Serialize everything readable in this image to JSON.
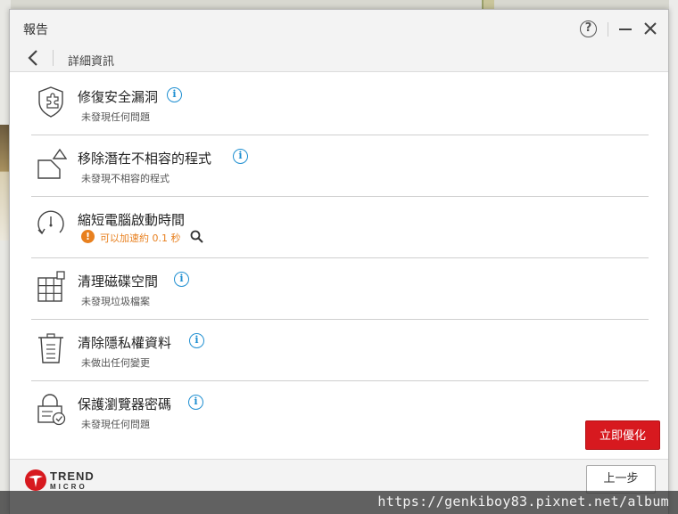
{
  "window": {
    "title": "報告",
    "help_label": "?",
    "breadcrumb": "詳細資訊"
  },
  "items": [
    {
      "icon": "shield-puzzle-icon",
      "title": "修復安全漏洞",
      "status": "未發現任何問題"
    },
    {
      "icon": "incompatible-app-icon",
      "title": "移除潛在不相容的程式",
      "status": "未發現不相容的程式"
    },
    {
      "icon": "startup-timer-icon",
      "title": "縮短電腦啟動時間",
      "status": "可以加速約 0.1 秒",
      "status_type": "warning"
    },
    {
      "icon": "disk-grid-icon",
      "title": "清理磁碟空間",
      "status": "未發現垃圾檔案"
    },
    {
      "icon": "trash-document-icon",
      "title": "清除隱私權資料",
      "status": "未做出任何變更"
    },
    {
      "icon": "lock-check-icon",
      "title": "保護瀏覽器密碼",
      "status": "未發現任何問題"
    }
  ],
  "info_glyph": "i",
  "warning_glyph": "!",
  "buttons": {
    "optimize": "立即優化",
    "previous": "上一步"
  },
  "logo": {
    "line1": "TREND",
    "line2": "MICRO"
  },
  "watermark": "https://genkiboy83.pixnet.net/album",
  "colors": {
    "accent_red": "#d7191f",
    "info_blue": "#1f8fd1",
    "warning_orange": "#e8801f"
  }
}
